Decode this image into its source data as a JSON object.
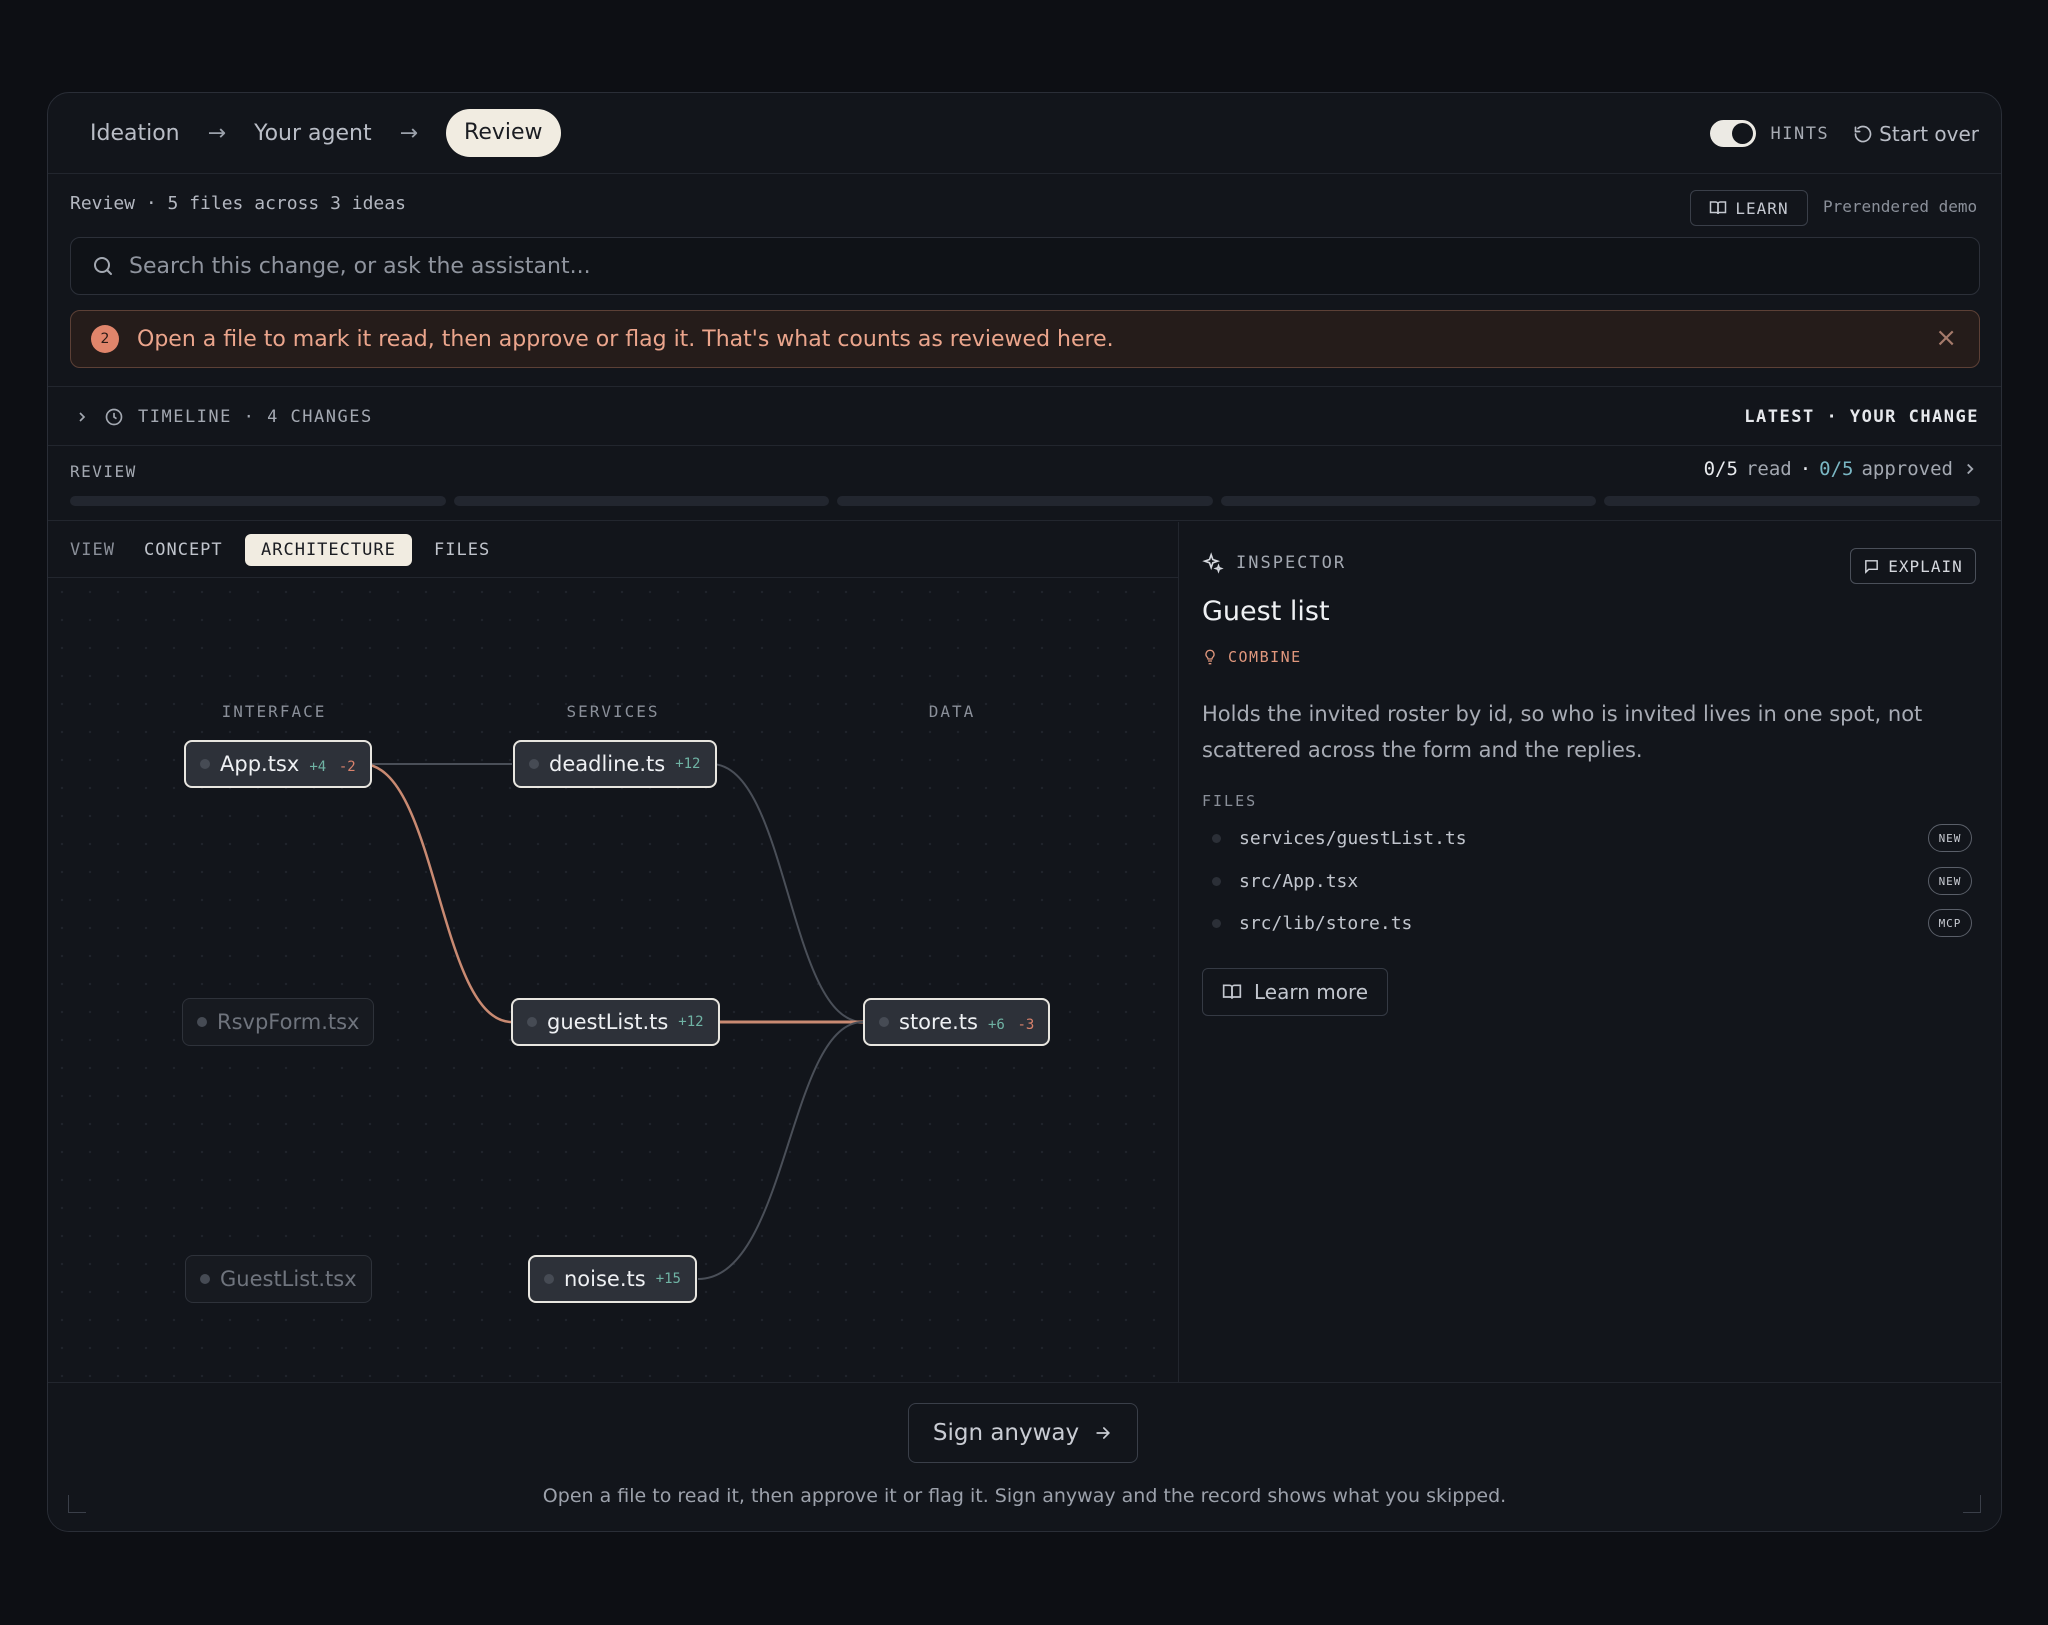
{
  "nav": {
    "steps": [
      "Ideation",
      "Your agent",
      "Review"
    ],
    "arrow": "→",
    "hints_label": "HINTS",
    "start_over": "Start over"
  },
  "subheader": {
    "title": "Review · 5 files across 3 ideas",
    "learn": "LEARN",
    "prerendered": "Prerendered demo"
  },
  "search": {
    "placeholder": "Search this change, or ask the assistant..."
  },
  "hint": {
    "number": "2",
    "text": "Open a file to mark it read, then approve or flag it. That's what counts as reviewed here."
  },
  "timeline": {
    "label": "TIMELINE · 4 CHANGES",
    "right": "LATEST · YOUR CHANGE"
  },
  "review": {
    "label": "REVIEW",
    "read": "0/5",
    "read_word": "read",
    "sep": "·",
    "approved": "0/5",
    "approved_word": "approved",
    "progress": [
      0,
      0,
      0,
      0,
      0
    ]
  },
  "view_tabs": {
    "label": "VIEW",
    "tabs": [
      "CONCEPT",
      "ARCHITECTURE",
      "FILES"
    ],
    "active": "ARCHITECTURE"
  },
  "graph": {
    "columns": [
      "INTERFACE",
      "SERVICES",
      "DATA"
    ],
    "nodes": [
      {
        "id": "app",
        "name": "App.tsx",
        "add": "+4",
        "del": "-2",
        "state": "live"
      },
      {
        "id": "deadline",
        "name": "deadline.ts",
        "add": "+12",
        "del": "",
        "state": "live"
      },
      {
        "id": "rsvp",
        "name": "RsvpForm.tsx",
        "add": "",
        "del": "",
        "state": "dim"
      },
      {
        "id": "guestlist",
        "name": "guestList.ts",
        "add": "+12",
        "del": "",
        "state": "live"
      },
      {
        "id": "store",
        "name": "store.ts",
        "add": "+6",
        "del": "-3",
        "state": "live"
      },
      {
        "id": "guestlisttsx",
        "name": "GuestList.tsx",
        "add": "",
        "del": "",
        "state": "dim"
      },
      {
        "id": "noise",
        "name": "noise.ts",
        "add": "+15",
        "del": "",
        "state": "live"
      }
    ],
    "edge_colors": {
      "active": "#c98a72",
      "idle": "#4a4f58"
    }
  },
  "inspector": {
    "label": "INSPECTOR",
    "explain": "EXPLAIN",
    "title": "Guest list",
    "tag": "COMBINE",
    "description": "Holds the invited roster by id, so who is invited lives in one spot, not scattered across the form and the replies.",
    "files_label": "FILES",
    "files": [
      {
        "path": "services/guestList.ts",
        "badge": "NEW"
      },
      {
        "path": "src/App.tsx",
        "badge": "NEW"
      },
      {
        "path": "src/lib/store.ts",
        "badge": "MCP"
      }
    ],
    "learn_more": "Learn more"
  },
  "footer": {
    "sign": "Sign anyway",
    "note": "Open a file to read it, then approve it or flag it. Sign anyway and the record shows what you skipped."
  }
}
